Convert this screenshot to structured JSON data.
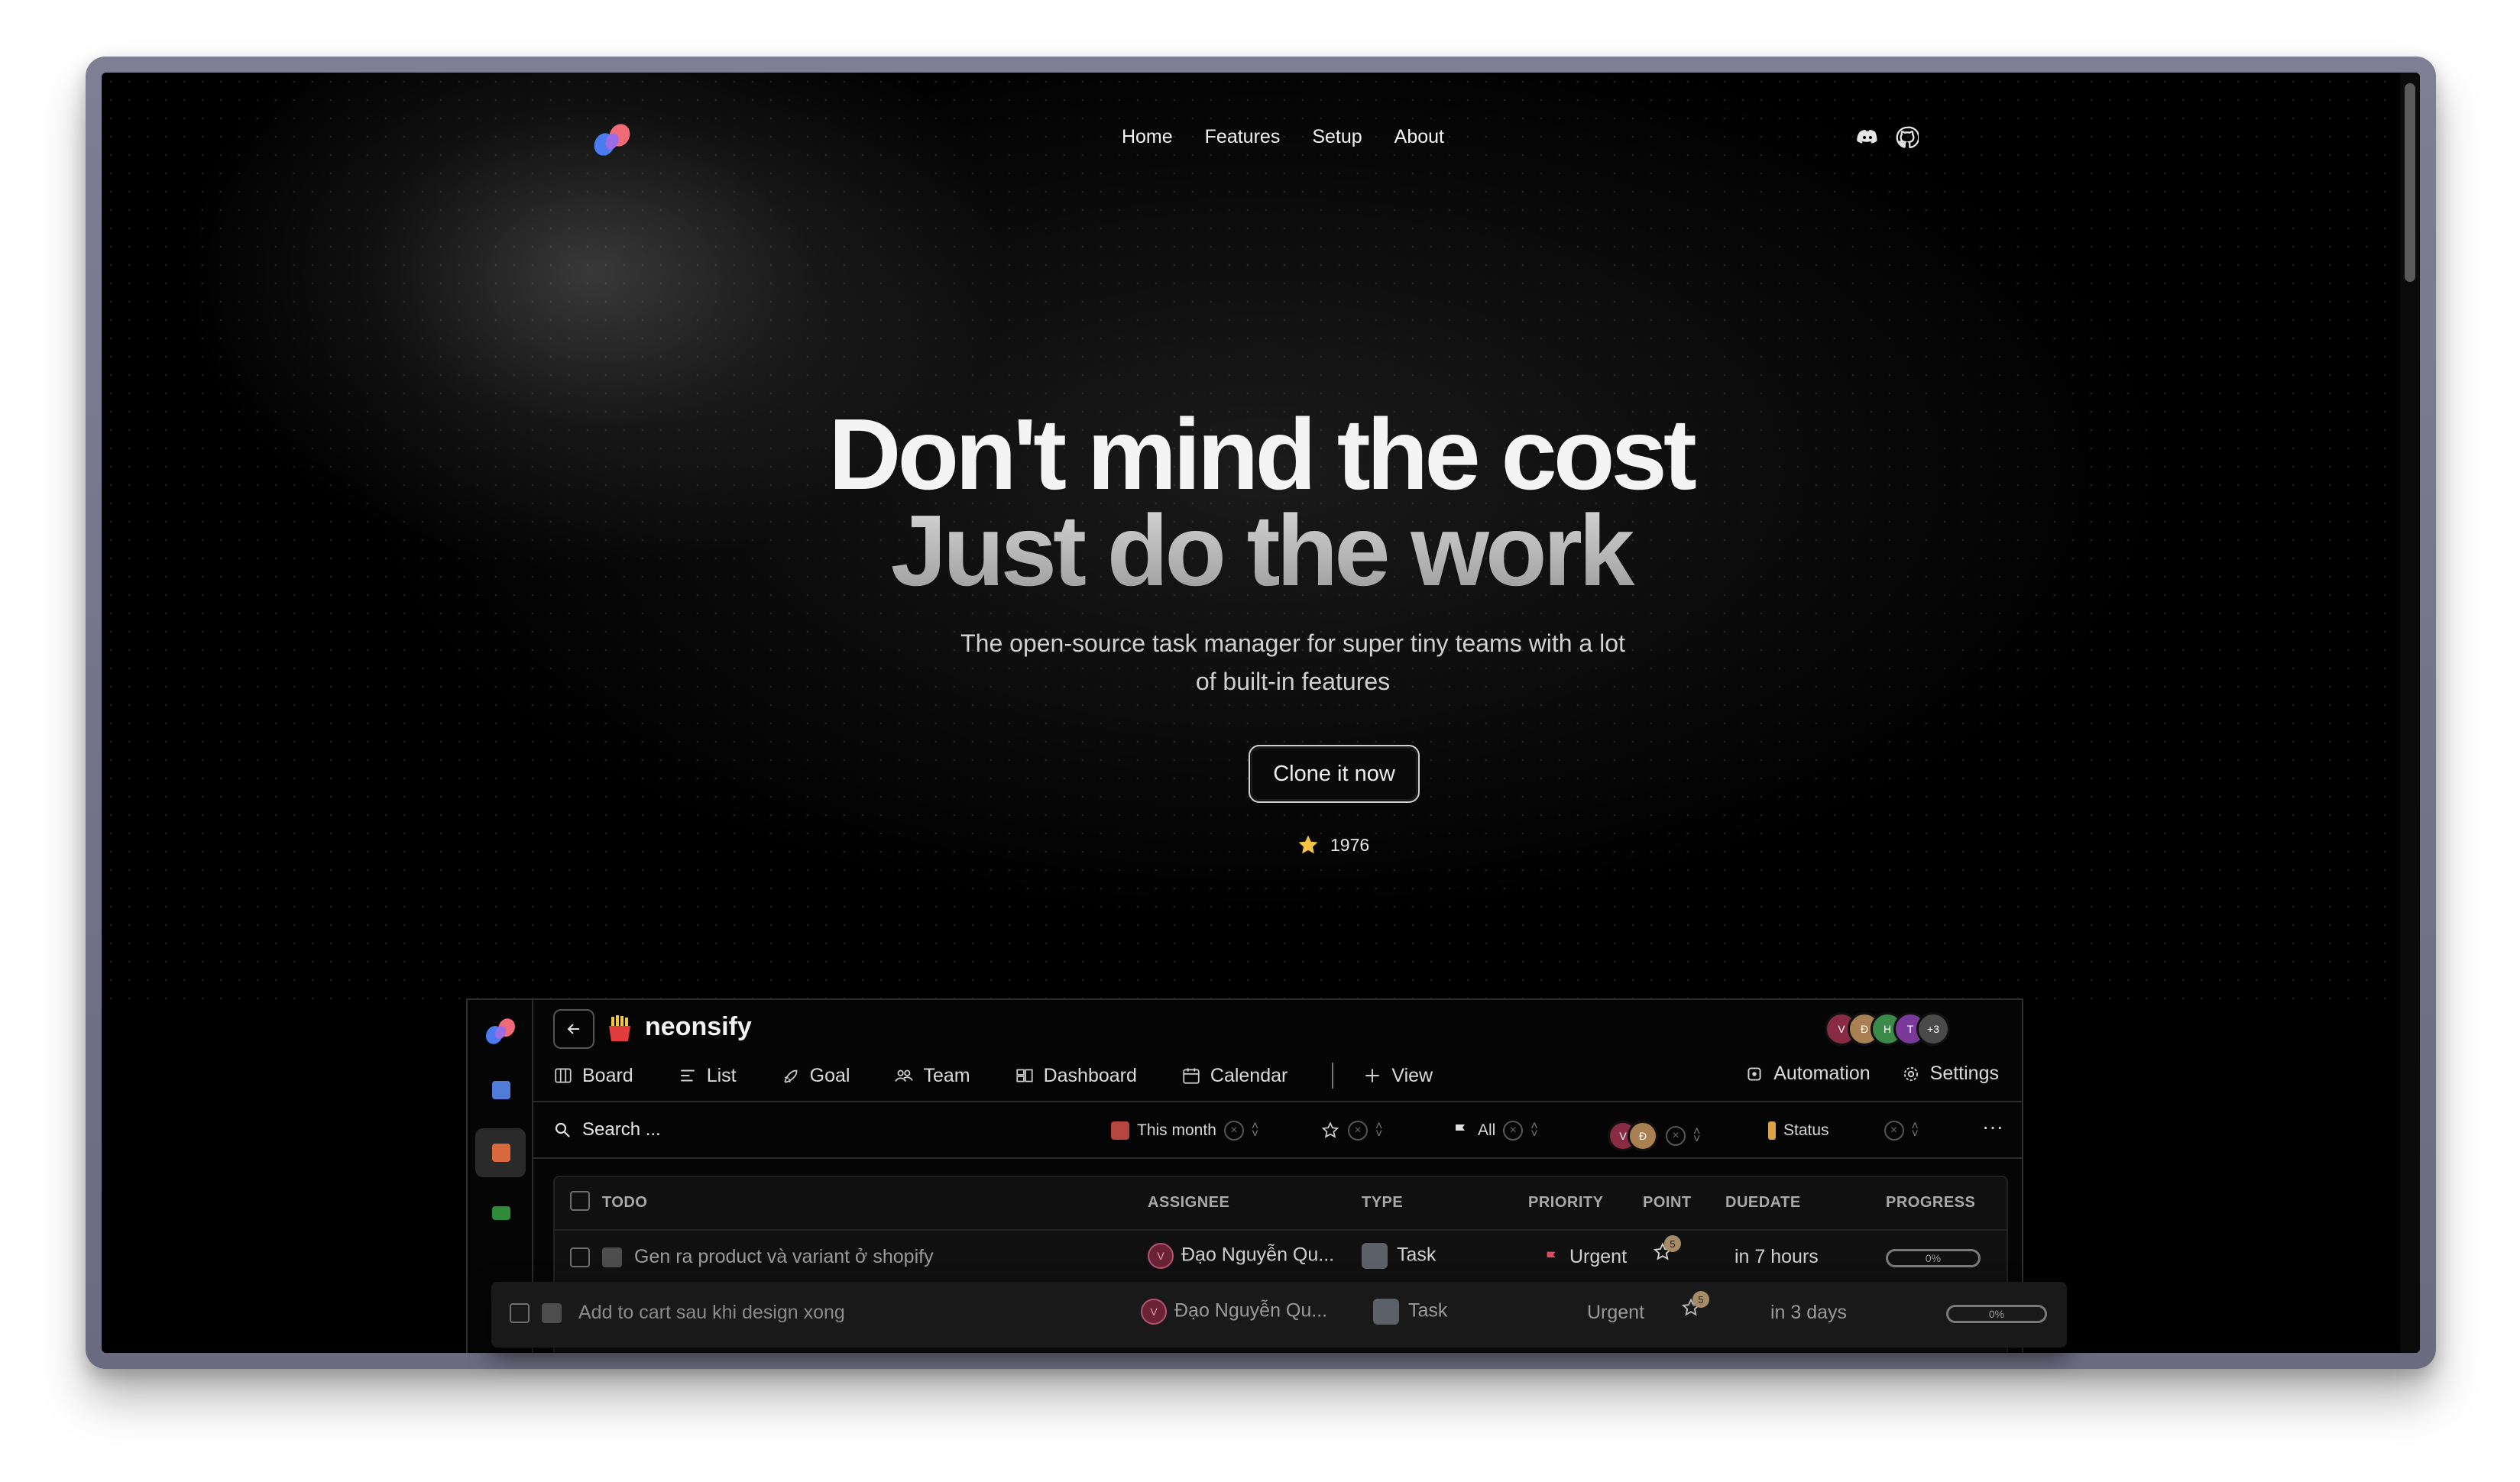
{
  "nav": {
    "links": [
      "Home",
      "Features",
      "Setup",
      "About"
    ],
    "icons": [
      "discord-icon",
      "github-icon"
    ]
  },
  "hero": {
    "line1": "Don't mind the cost",
    "line2": "Just do the work",
    "subtitle": "The open-source task manager for super tiny teams with a lot of built-in features",
    "cta": "Clone it now",
    "stars": "1976"
  },
  "app": {
    "project": "neonsify",
    "avatars": [
      "V",
      "Đ",
      "H",
      "T",
      "+3"
    ],
    "tabs": [
      "Board",
      "List",
      "Goal",
      "Team",
      "Dashboard",
      "Calendar",
      "View"
    ],
    "tabs_right": [
      "Automation",
      "Settings"
    ],
    "filters": {
      "search_placeholder": "Search ...",
      "date": "This month",
      "priority": "All",
      "status": "Status",
      "assignees": [
        "V",
        "Đ"
      ]
    },
    "table": {
      "headers": [
        "TODO",
        "ASSIGNEE",
        "TYPE",
        "PRIORITY",
        "POINT",
        "DUEDATE",
        "PROGRESS"
      ],
      "rows": [
        {
          "title": "Gen ra product và variant ở shopify",
          "assignee": "Đạo Nguyễn Qu...",
          "assignee_initial": "V",
          "type": "Task",
          "priority": "Urgent",
          "point": "5",
          "due": "in 7 hours",
          "progress": "0%"
        },
        {
          "title": "Add to cart sau khi design xong",
          "assignee": "Đạo Nguyễn Qu...",
          "assignee_initial": "V",
          "type": "Task",
          "priority": "Urgent",
          "point": "5",
          "due": "in 3 days",
          "progress": "0%"
        }
      ]
    }
  },
  "colors": {
    "background": "#000000",
    "frame": "#74748a",
    "urgent": "#e04a5f",
    "star": "#f5c242"
  }
}
